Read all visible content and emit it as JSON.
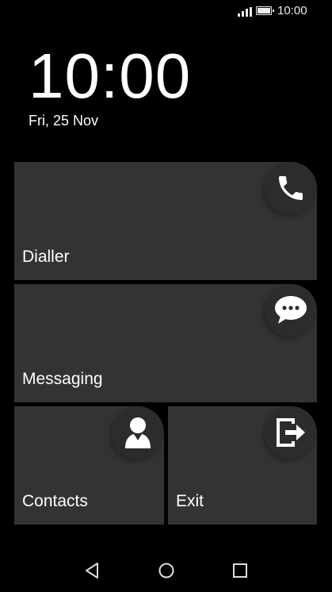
{
  "status_bar": {
    "time": "10:00",
    "icons": [
      "signal-icon",
      "battery-icon"
    ]
  },
  "lockscreen": {
    "clock": "10:00",
    "date": "Fri, 25 Nov"
  },
  "tiles": {
    "dialler": {
      "label": "Dialler",
      "icon": "phone-icon"
    },
    "messaging": {
      "label": "Messaging",
      "icon": "chat-bubble-icon"
    },
    "contacts": {
      "label": "Contacts",
      "icon": "person-icon"
    },
    "exit": {
      "label": "Exit",
      "icon": "exit-icon"
    }
  },
  "nav_bar": {
    "buttons": [
      "back-icon",
      "home-icon",
      "recent-apps-icon"
    ]
  },
  "colors": {
    "background": "#000000",
    "tile": "#333333",
    "icon_circle": "#2c2c2c",
    "text": "#ffffff"
  }
}
